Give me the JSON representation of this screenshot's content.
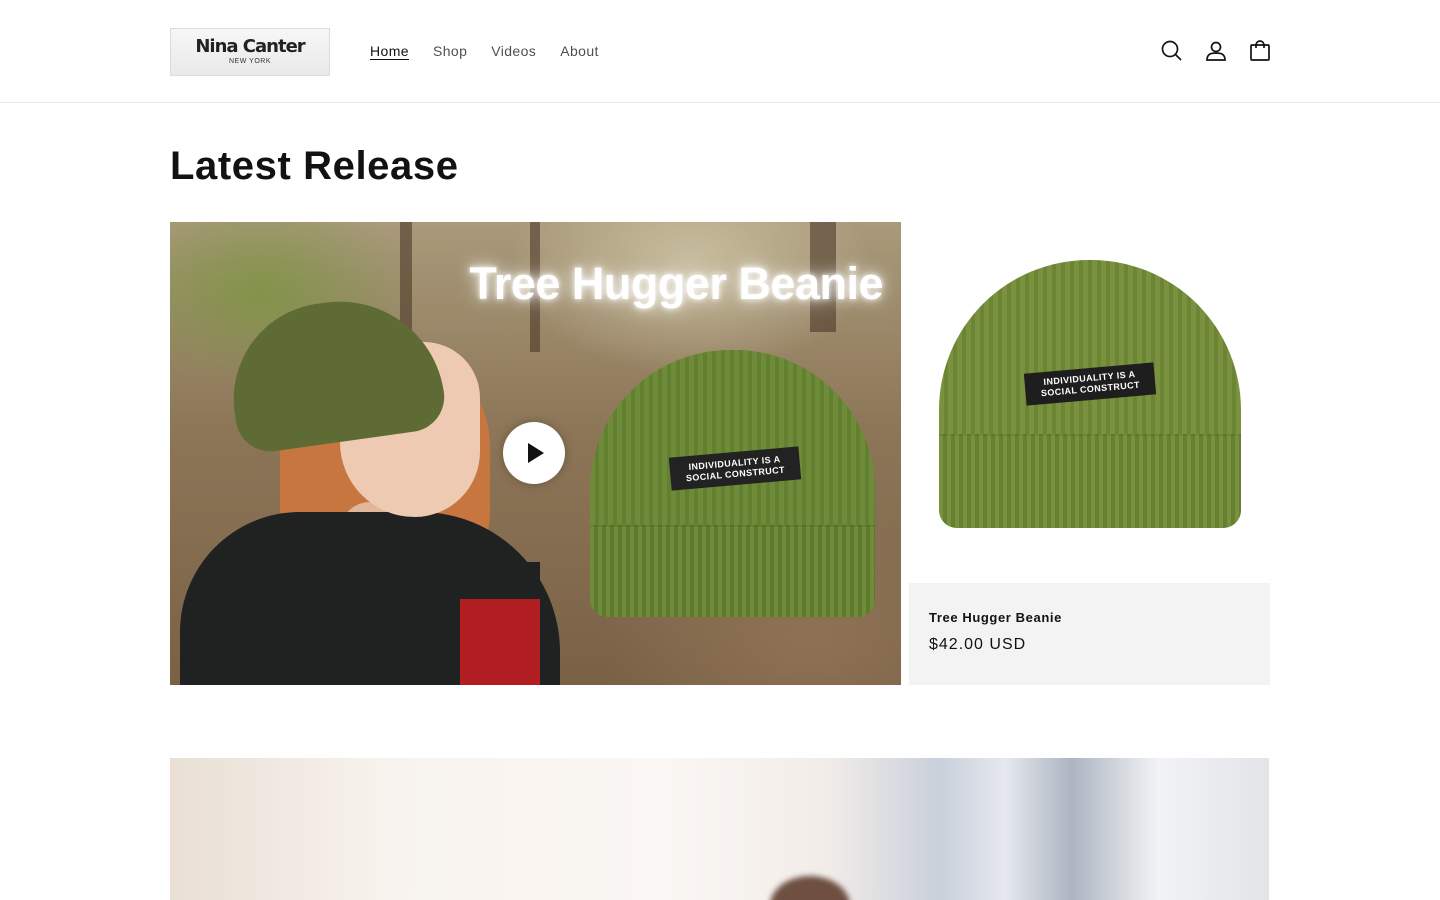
{
  "header": {
    "logo": {
      "name": "Nina Canter",
      "sub": "NEW YORK"
    },
    "nav": [
      {
        "label": "Home",
        "active": true
      },
      {
        "label": "Shop",
        "active": false
      },
      {
        "label": "Videos",
        "active": false
      },
      {
        "label": "About",
        "active": false
      }
    ],
    "icons": [
      "search-icon",
      "account-icon",
      "cart-icon"
    ]
  },
  "section": {
    "title": "Latest Release"
  },
  "video": {
    "overlay_title": "Tree Hugger Beanie",
    "patch_text": "INDIVIDUALITY IS A SOCIAL CONSTRUCT"
  },
  "product": {
    "name": "Tree Hugger Beanie",
    "price": "$42.00 USD",
    "patch_text": "INDIVIDUALITY IS A SOCIAL CONSTRUCT"
  },
  "colors": {
    "text": "#121212",
    "product_bg": "#f3f3f3",
    "beanie_green": "#7a923f"
  }
}
